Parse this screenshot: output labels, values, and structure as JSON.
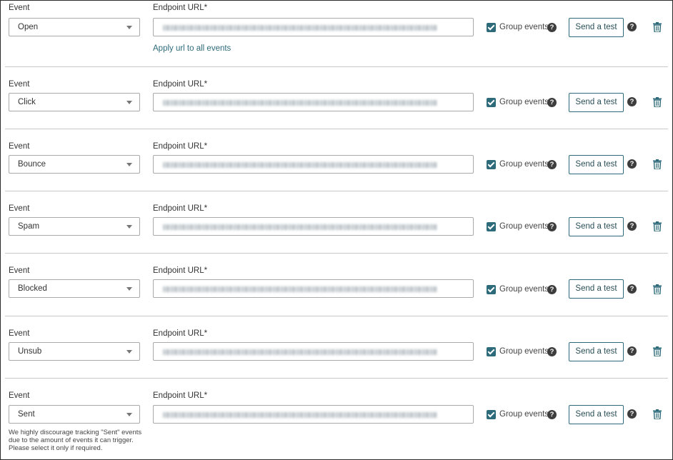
{
  "labels": {
    "event": "Event",
    "endpoint": "Endpoint URL*",
    "group_events": "Group events",
    "send_test": "Send a test",
    "help": "?"
  },
  "apply_url_link": "Apply url to all events",
  "events": [
    {
      "value": "Open",
      "group_checked": true
    },
    {
      "value": "Click",
      "group_checked": true
    },
    {
      "value": "Bounce",
      "group_checked": true
    },
    {
      "value": "Spam",
      "group_checked": true
    },
    {
      "value": "Blocked",
      "group_checked": true
    },
    {
      "value": "Unsub",
      "group_checked": true
    },
    {
      "value": "Sent",
      "group_checked": true
    }
  ],
  "sent_note": {
    "line1": "We highly discourage tracking \"Sent\" events",
    "line2": "due to the amount of events it can trigger.",
    "line3": "Please select it only if required."
  },
  "colors": {
    "accent": "#2e6b7a",
    "border": "#a9a9a9",
    "divider": "#c9c9c9"
  },
  "icons": {
    "dropdown": "chevron-down-icon",
    "help": "question-circle-icon",
    "delete": "trash-icon",
    "checkbox": "check-icon"
  }
}
